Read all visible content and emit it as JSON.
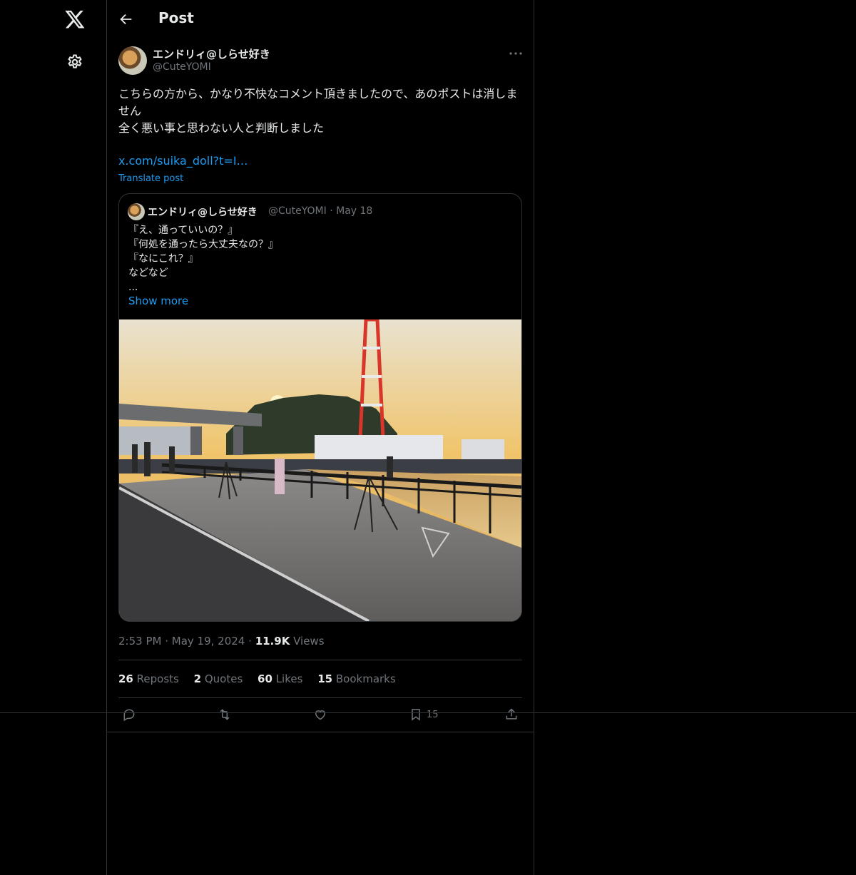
{
  "nav": {
    "logo": "x-logo-icon",
    "settings": "gear-icon"
  },
  "header": {
    "title": "Post",
    "back_icon": "back-arrow-icon"
  },
  "post": {
    "author_name": "エンドリィ@しらせ好き",
    "author_handle": "@CuteYOMI",
    "text_line1": "こちらの方から、かなり不快なコメント頂きましたので、あのポストは消しません",
    "text_line2": "全く悪い事と思わない人と判断しました",
    "link": "x.com/suika_doll?t=I…",
    "translate": "Translate post",
    "time": "2:53 PM",
    "date": "May 19, 2024",
    "views_count": "11.9K",
    "views_label": "Views"
  },
  "quote": {
    "author_name": "エンドリィ@しらせ好き",
    "author_handle": "@CuteYOMI",
    "date": "May 18",
    "lines": [
      "『え、通っていいの？』",
      "『何処を通ったら大丈夫なの？』",
      "『なにこれ？』",
      "などなど",
      "..."
    ],
    "show_more": "Show more"
  },
  "stats": {
    "reposts": {
      "count": "26",
      "label": "Reposts"
    },
    "quotes": {
      "count": "2",
      "label": "Quotes"
    },
    "likes": {
      "count": "60",
      "label": "Likes"
    },
    "bookmarks": {
      "count": "15",
      "label": "Bookmarks"
    }
  },
  "actions": {
    "bookmark_count": "15"
  },
  "colors": {
    "accent": "#1d9bf0",
    "muted": "#71767b",
    "border": "#2f3336",
    "background": "#000000"
  }
}
